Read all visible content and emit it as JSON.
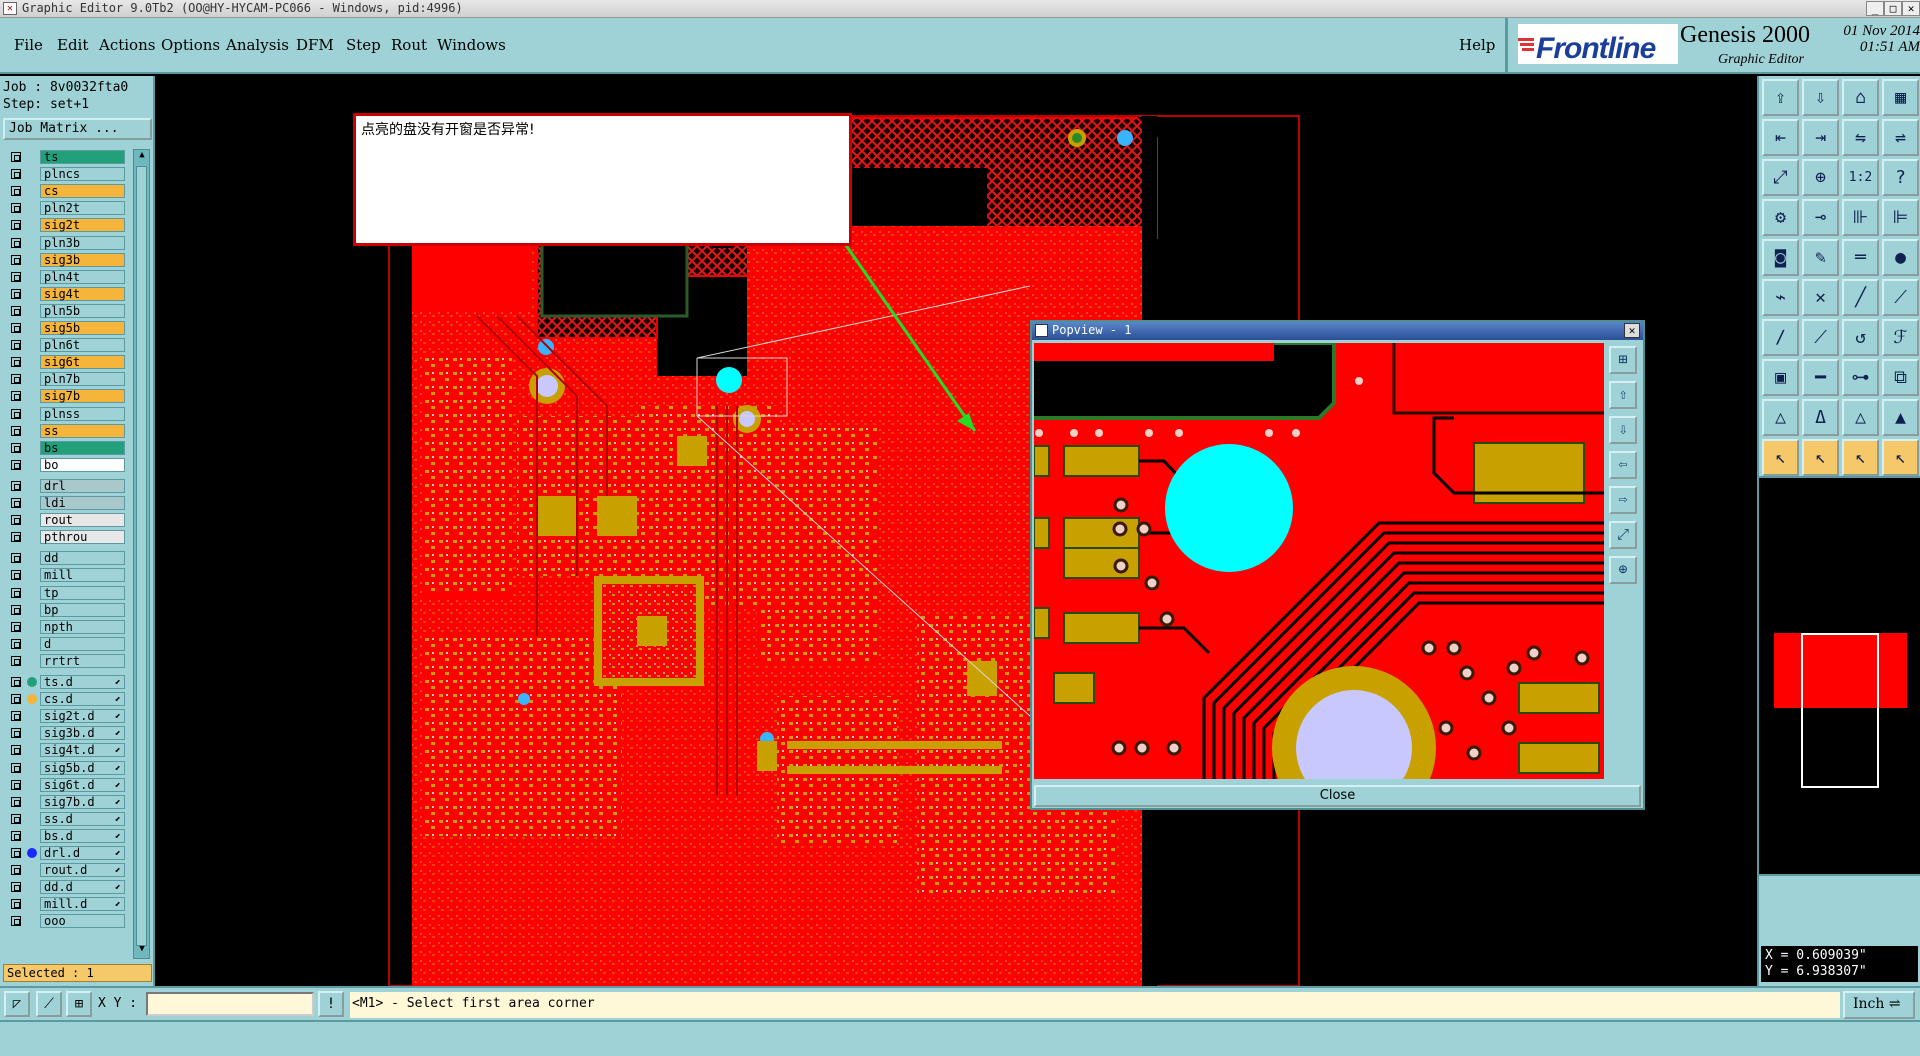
{
  "window": {
    "title": "Graphic Editor 9.0Tb2 (OO@HY-HYCAM-PC066 - Windows, pid:4996)"
  },
  "menu": {
    "items": [
      {
        "label": "File"
      },
      {
        "label": "Edit"
      },
      {
        "label": "Actions"
      },
      {
        "label": "Options"
      },
      {
        "label": "Analysis"
      },
      {
        "label": "DFM"
      },
      {
        "label": "Step"
      },
      {
        "label": "Rout"
      },
      {
        "label": "Windows"
      }
    ],
    "help": "Help"
  },
  "brand": {
    "logo": "Frontline",
    "product": "Genesis 2000",
    "subtitle": "Graphic Editor",
    "date": "01 Nov 2014",
    "time": "01:51 AM"
  },
  "job": {
    "job_line": "Job : 8v0032fta0",
    "step_line": "Step: set+1",
    "matrix_button": "Job Matrix ..."
  },
  "layers": [
    {
      "name": "ts",
      "color": "#22a07a"
    },
    {
      "name": "plncs",
      "color": "#9ed2d6"
    },
    {
      "name": "cs",
      "color": "#f5b43a"
    },
    {
      "name": "pln2t",
      "color": "#9ed2d6"
    },
    {
      "name": "sig2t",
      "color": "#f5b43a"
    },
    {
      "name": "pln3b",
      "color": "#9ed2d6"
    },
    {
      "name": "sig3b",
      "color": "#f5b43a"
    },
    {
      "name": "pln4t",
      "color": "#9ed2d6"
    },
    {
      "name": "sig4t",
      "color": "#f5b43a"
    },
    {
      "name": "pln5b",
      "color": "#9ed2d6"
    },
    {
      "name": "sig5b",
      "color": "#f5b43a"
    },
    {
      "name": "pln6t",
      "color": "#9ed2d6"
    },
    {
      "name": "sig6t",
      "color": "#f5b43a"
    },
    {
      "name": "pln7b",
      "color": "#9ed2d6"
    },
    {
      "name": "sig7b",
      "color": "#f5b43a"
    },
    {
      "name": "plnss",
      "color": "#9ed2d6"
    },
    {
      "name": "ss",
      "color": "#f5b43a"
    },
    {
      "name": "bs",
      "color": "#22a07a"
    },
    {
      "name": "bo",
      "color": "#ffffff"
    },
    {
      "name": "drl",
      "color": "#a8c8cc"
    },
    {
      "name": "ldi",
      "color": "#a8c8cc"
    },
    {
      "name": "rout",
      "color": "#e8e8e8"
    },
    {
      "name": "pthrou",
      "color": "#e8e8e8"
    },
    {
      "name": "dd",
      "color": "#9ed2d6"
    },
    {
      "name": "mill",
      "color": "#9ed2d6"
    },
    {
      "name": "tp",
      "color": "#9ed2d6"
    },
    {
      "name": "bp",
      "color": "#9ed2d6"
    },
    {
      "name": "npth",
      "color": "#9ed2d6"
    },
    {
      "name": "d",
      "color": "#9ed2d6"
    },
    {
      "name": "rrtrt",
      "color": "#9ed2d6"
    },
    {
      "name": "ts.d",
      "color": "#9ed2d6"
    },
    {
      "name": "cs.d",
      "color": "#9ed2d6"
    },
    {
      "name": "sig2t.d",
      "color": "#9ed2d6"
    },
    {
      "name": "sig3b.d",
      "color": "#9ed2d6"
    },
    {
      "name": "sig4t.d",
      "color": "#9ed2d6"
    },
    {
      "name": "sig5b.d",
      "color": "#9ed2d6"
    },
    {
      "name": "sig6t.d",
      "color": "#9ed2d6"
    },
    {
      "name": "sig7b.d",
      "color": "#9ed2d6"
    },
    {
      "name": "ss.d",
      "color": "#9ed2d6"
    },
    {
      "name": "bs.d",
      "color": "#9ed2d6"
    },
    {
      "name": "drl.d",
      "color": "#9ed2d6"
    },
    {
      "name": "rout.d",
      "color": "#9ed2d6"
    },
    {
      "name": "dd.d",
      "color": "#9ed2d6"
    },
    {
      "name": "mill.d",
      "color": "#9ed2d6"
    },
    {
      "name": "ooo",
      "color": "#9ed2d6"
    }
  ],
  "selected": "Selected : 1",
  "note": {
    "text": "点亮的盘没有开窗是否异常!"
  },
  "popview": {
    "title": "Popview - 1",
    "close_button": "Close"
  },
  "coords": {
    "x": "X = 0.609039\"",
    "y": "Y = 6.938307\""
  },
  "bottom": {
    "xy_label": "X Y :",
    "xy_value": "",
    "message": "<M1> - Select first area corner",
    "units": "Inch"
  },
  "colors": {
    "panel": "#9ed2d6",
    "copper": "#ff0000",
    "pad": "#c8a000",
    "highlight": "#00ffff",
    "arrow": "#22cc22"
  }
}
